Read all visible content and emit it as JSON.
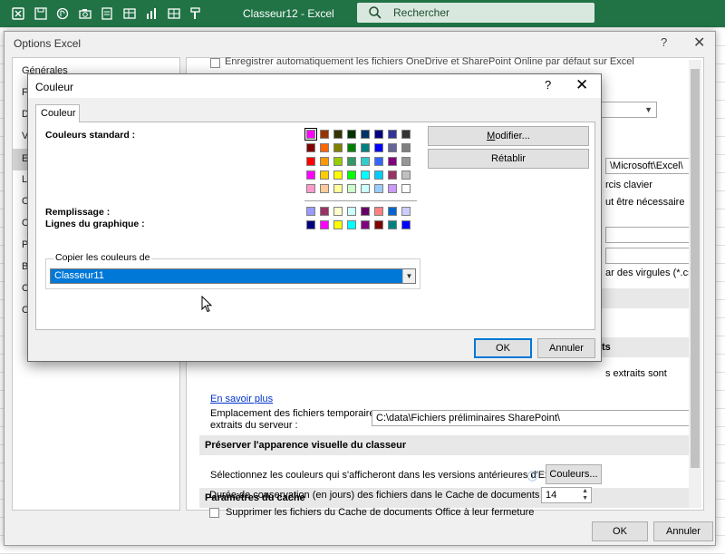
{
  "excel": {
    "title": "Classeur12  -  Excel",
    "search_placeholder": "Rechercher",
    "qat_icons": [
      "excel-logo-icon",
      "save-icon",
      "onedrive-sync-icon",
      "camera-icon",
      "form-icon",
      "new-sheet-icon",
      "chart-icon",
      "table-icon",
      "format-painter-icon"
    ]
  },
  "options": {
    "title": "Options Excel",
    "help": "?",
    "close": "✕",
    "nav": [
      "Générales",
      "Fo",
      "D",
      "V",
      "En",
      "La",
      "O",
      "O",
      "Pe",
      "Ba",
      "C",
      "C"
    ],
    "content": {
      "top_partial": "Enregistrer automatiquement les fichiers OneDrive et SharePoint Online par défaut sur Excel",
      "path_partial": "\\Microsoft\\Excel\\",
      "keyboard_partial": "rcis clavier",
      "needed_partial": "ut être nécessaire",
      "csv_partial": "ar des virgules (*.csv)",
      "section_partial": "ts",
      "extracted_partial": "s extraits sont",
      "learn_more": "En savoir plus",
      "temp_label_1": "Emplacement des fichiers temporaires",
      "temp_label_2": "extraits du serveur :",
      "temp_path": "C:\\data\\Fichiers préliminaires SharePoint\\",
      "preserve_section": "Préserver l'apparence visuelle du classeur",
      "colors_text": "Sélectionnez les couleurs qui s'afficheront dans les versions antérieures d'Excel :",
      "info_glyph": "ⓘ",
      "colors_button": "Couleurs...",
      "cache_section": "Paramètres du cache",
      "cache_days_label": "Durée de conservation (en jours) des fichiers dans le Cache de documents Office :",
      "cache_days_value": "14",
      "delete_cache_label": "Supprimer les fichiers du Cache de documents Office à leur fermeture"
    },
    "ok": "OK",
    "cancel": "Annuler"
  },
  "couleur": {
    "title": "Couleur",
    "help": "?",
    "close": "✕",
    "tab": "Couleur",
    "standard_label": "Couleurs standard :",
    "fill_label": "Remplissage :",
    "chart_lines_label": "Lignes du graphique :",
    "modify_button": "Modifier...",
    "reset_button": "Rétablir",
    "copy_from_label": "Copier les couleurs de",
    "copy_from_value": "Classeur11",
    "ok": "OK",
    "cancel": "Annuler",
    "standard_colors": [
      [
        "#FF00FF",
        "#993300",
        "#333300",
        "#003300",
        "#003366",
        "#000080",
        "#333399",
        "#333333"
      ],
      [
        "#800000",
        "#FF6600",
        "#808000",
        "#008000",
        "#008080",
        "#0000FF",
        "#666699",
        "#808080"
      ],
      [
        "#FF0000",
        "#FF9900",
        "#99CC00",
        "#339966",
        "#33CCCC",
        "#3366FF",
        "#800080",
        "#969696"
      ],
      [
        "#FF00FF",
        "#FFCC00",
        "#FFFF00",
        "#00FF00",
        "#00FFFF",
        "#00CCFF",
        "#993366",
        "#C0C0C0"
      ],
      [
        "#FF99CC",
        "#FFCC99",
        "#FFFF99",
        "#CCFFCC",
        "#CCFFFF",
        "#99CCFF",
        "#CC99FF",
        "#FFFFFF"
      ]
    ],
    "fill_colors": [
      "#9999FF",
      "#993366",
      "#FFFFCC",
      "#CCFFFF",
      "#660066",
      "#FF8080",
      "#0066CC",
      "#CCCCFF"
    ],
    "line_colors": [
      "#000080",
      "#FF00FF",
      "#FFFF00",
      "#00FFFF",
      "#800080",
      "#800000",
      "#008080",
      "#0000FF"
    ],
    "selected_color": "#FF00FF"
  }
}
